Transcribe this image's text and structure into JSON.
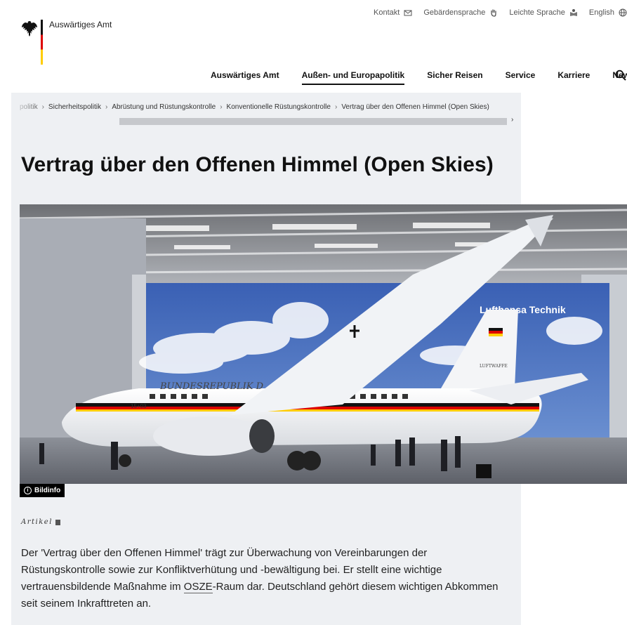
{
  "header": {
    "logo_text": "Auswärtiges Amt",
    "meta_nav": [
      {
        "label": "Kontakt",
        "icon": "mail-icon"
      },
      {
        "label": "Gebärdensprache",
        "icon": "hand-icon"
      },
      {
        "label": "Leichte Sprache",
        "icon": "easy-language-icon"
      },
      {
        "label": "English",
        "icon": "globe-icon"
      }
    ],
    "main_nav": [
      {
        "label": "Auswärtiges Amt",
        "active": false
      },
      {
        "label": "Außen- und Europapolitik",
        "active": true
      },
      {
        "label": "Sicher Reisen",
        "active": false
      },
      {
        "label": "Service",
        "active": false
      },
      {
        "label": "Karriere",
        "active": false
      },
      {
        "label": "News",
        "active": false
      }
    ]
  },
  "breadcrumb": [
    "politik",
    "Sicherheitspolitik",
    "Abrüstung und Rüstungskontrolle",
    "Konventionelle Rüstungskontrolle",
    "Vertrag über den Offenen Himmel (Open Skies)"
  ],
  "breadcrumb_scroll_arrow": "›",
  "article": {
    "title": "Vertrag über den Offenen Himmel (Open Skies)",
    "image_info_label": "Bildinfo",
    "category": "Artikel",
    "lead_part1": "Der 'Vertrag über den Offenen Himmel' trägt zur Überwachung von Vereinbarungen der Rüstungskontrolle sowie zur Konfliktverhütung und -bewältigung bei. Er stellt eine wichtige vertrauensbildende Maßnahme im ",
    "lead_abbr": "OSZE",
    "lead_part2": "-Raum dar. Deutschland gehört diesem wichtigen Abkommen seit seinem Inkrafttreten an."
  },
  "image": {
    "fuselage_text": "BUNDESREPUBLIK D",
    "registration": "15+03",
    "banner_text": "Lufthansa Technik",
    "tail_text": "LUFTWAFFE"
  },
  "colors": {
    "panel_bg": "#eef0f3",
    "sky": "#3d64b7",
    "black": "#111111",
    "red": "#dd0000",
    "gold": "#ffcc00"
  }
}
